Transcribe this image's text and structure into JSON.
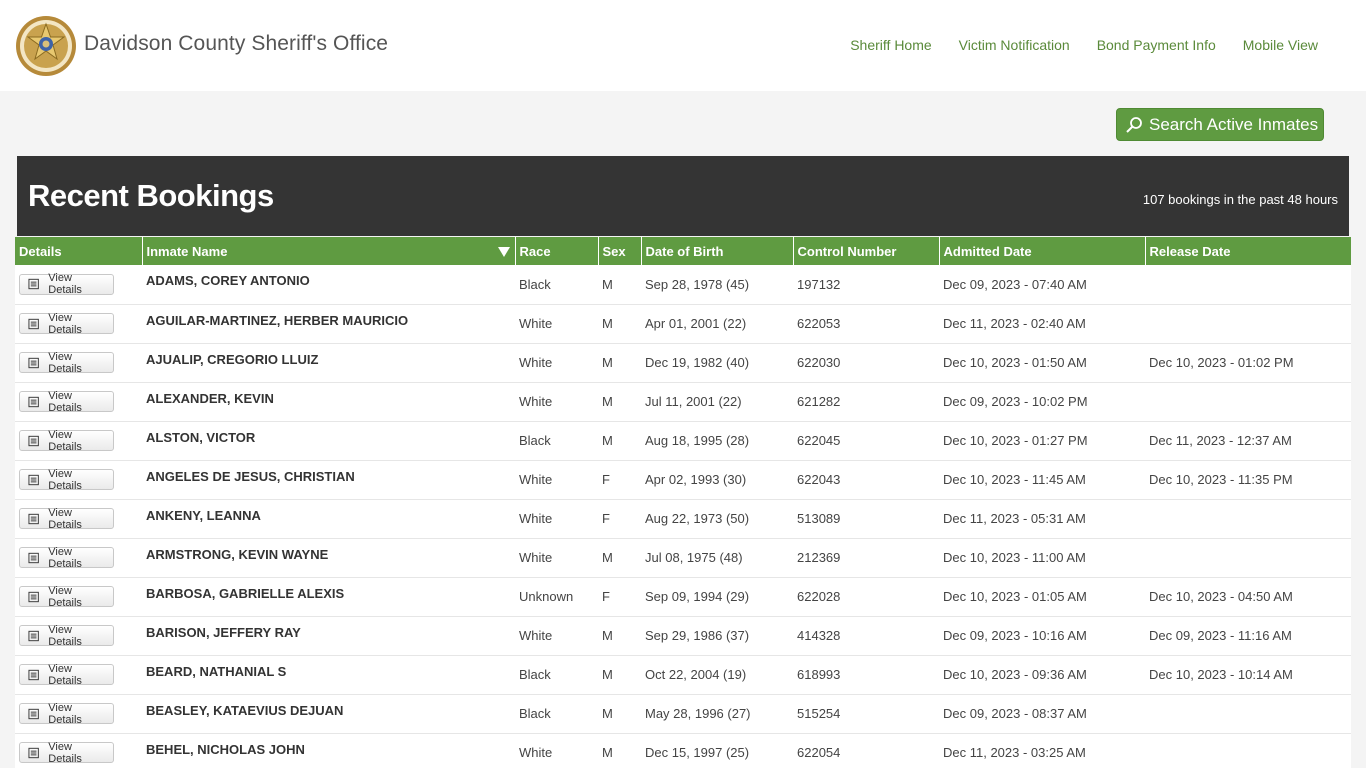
{
  "header": {
    "site_title": "Davidson County Sheriff's Office",
    "logo_icon": "sheriff-star-badge",
    "nav": [
      "Sheriff Home",
      "Victim Notification",
      "Bond Payment Info",
      "Mobile View"
    ]
  },
  "search": {
    "label": "Search Active Inmates",
    "icon": "magnifier-icon"
  },
  "panel": {
    "title": "Recent Bookings",
    "count_text": "107 bookings in the past 48 hours"
  },
  "table": {
    "columns": [
      "Details",
      "Inmate Name",
      "Race",
      "Sex",
      "Date of Birth",
      "Control Number",
      "Admitted Date",
      "Release Date"
    ],
    "view_details_label": "View Details",
    "rows": [
      {
        "name": "ADAMS, COREY  ANTONIO",
        "race": "Black",
        "sex": "M",
        "dob": "Sep 28, 1978 (45)",
        "control": "197132",
        "admitted": "Dec 09, 2023 - 07:40 AM",
        "release": ""
      },
      {
        "name": "AGUILAR-MARTINEZ, HERBER  MAURICIO",
        "race": "White",
        "sex": "M",
        "dob": "Apr 01, 2001 (22)",
        "control": "622053",
        "admitted": "Dec 11, 2023 - 02:40 AM",
        "release": ""
      },
      {
        "name": "AJUALIP, CREGORIO  LLUIZ",
        "race": "White",
        "sex": "M",
        "dob": "Dec 19, 1982 (40)",
        "control": "622030",
        "admitted": "Dec 10, 2023 - 01:50 AM",
        "release": "Dec 10, 2023 - 01:02 PM"
      },
      {
        "name": "ALEXANDER, KEVIN",
        "race": "White",
        "sex": "M",
        "dob": "Jul 11, 2001 (22)",
        "control": "621282",
        "admitted": "Dec 09, 2023 - 10:02 PM",
        "release": ""
      },
      {
        "name": "ALSTON, VICTOR",
        "race": "Black",
        "sex": "M",
        "dob": "Aug 18, 1995 (28)",
        "control": "622045",
        "admitted": "Dec 10, 2023 - 01:27 PM",
        "release": "Dec 11, 2023 - 12:37 AM"
      },
      {
        "name": "ANGELES DE JESUS, CHRISTIAN",
        "race": "White",
        "sex": "F",
        "dob": "Apr 02, 1993 (30)",
        "control": "622043",
        "admitted": "Dec 10, 2023 - 11:45 AM",
        "release": "Dec 10, 2023 - 11:35 PM"
      },
      {
        "name": "ANKENY, LEANNA",
        "race": "White",
        "sex": "F",
        "dob": "Aug 22, 1973 (50)",
        "control": "513089",
        "admitted": "Dec 11, 2023 - 05:31 AM",
        "release": ""
      },
      {
        "name": "ARMSTRONG, KEVIN  WAYNE",
        "race": "White",
        "sex": "M",
        "dob": "Jul 08, 1975 (48)",
        "control": "212369",
        "admitted": "Dec 10, 2023 - 11:00 AM",
        "release": ""
      },
      {
        "name": "BARBOSA, GABRIELLE  ALEXIS",
        "race": "Unknown",
        "sex": "F",
        "dob": "Sep 09, 1994 (29)",
        "control": "622028",
        "admitted": "Dec 10, 2023 - 01:05 AM",
        "release": "Dec 10, 2023 - 04:50 AM"
      },
      {
        "name": "BARISON, JEFFERY  RAY",
        "race": "White",
        "sex": "M",
        "dob": "Sep 29, 1986 (37)",
        "control": "414328",
        "admitted": "Dec 09, 2023 - 10:16 AM",
        "release": "Dec 09, 2023 - 11:16 AM"
      },
      {
        "name": "BEARD, NATHANIAL  S",
        "race": "Black",
        "sex": "M",
        "dob": "Oct 22, 2004 (19)",
        "control": "618993",
        "admitted": "Dec 10, 2023 - 09:36 AM",
        "release": "Dec 10, 2023 - 10:14 AM"
      },
      {
        "name": "BEASLEY, KATAEVIUS  DEJUAN",
        "race": "Black",
        "sex": "M",
        "dob": "May 28, 1996 (27)",
        "control": "515254",
        "admitted": "Dec 09, 2023 - 08:37 AM",
        "release": ""
      },
      {
        "name": "BEHEL, NICHOLAS  JOHN",
        "race": "White",
        "sex": "M",
        "dob": "Dec 15, 1997 (25)",
        "control": "622054",
        "admitted": "Dec 11, 2023 - 03:25 AM",
        "release": ""
      }
    ]
  },
  "colors": {
    "accent": "#5f9b41",
    "panel": "#343434",
    "nav_link": "#5a8a3a"
  }
}
